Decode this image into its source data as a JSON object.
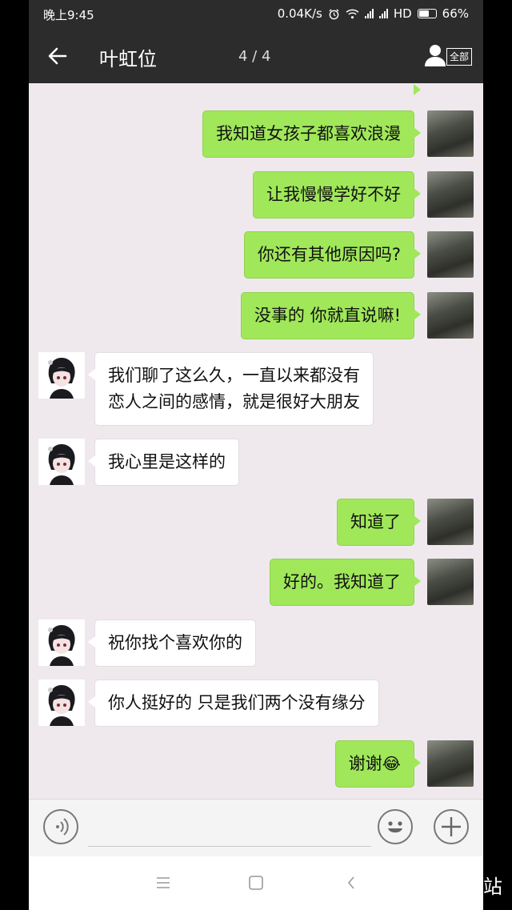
{
  "status_bar": {
    "time": "晚上9:45",
    "network_speed": "0.04K/s",
    "network_type": "HD",
    "battery": "66%",
    "battery_level": 0.66
  },
  "header": {
    "back_icon": "arrow-left-icon",
    "title": "叶虹位",
    "pager": "4 / 4",
    "contacts_label": "全部"
  },
  "messages": [
    {
      "side": "out",
      "text": "我知道女孩子都喜欢浪漫"
    },
    {
      "side": "out",
      "text": "让我慢慢学好不好"
    },
    {
      "side": "out",
      "text": "你还有其他原因吗?"
    },
    {
      "side": "out",
      "text": "没事的 你就直说嘛!"
    },
    {
      "side": "in",
      "lines": [
        "我们聊了这么久，一直以来都没有",
        "恋人之间的感情，就是很好大朋友"
      ]
    },
    {
      "side": "in",
      "text": "我心里是这样的"
    },
    {
      "side": "out",
      "text": "知道了"
    },
    {
      "side": "out",
      "text": "好的。我知道了"
    },
    {
      "side": "in",
      "text": "祝你找个喜欢你的"
    },
    {
      "side": "in",
      "text": "你人挺好的 只是我们两个没有缘分"
    },
    {
      "side": "out",
      "text": "谢谢",
      "emoji": "😂"
    }
  ],
  "input_bar": {
    "voice_icon": "voice-icon",
    "emoji_icon": "emoji-icon",
    "plus_icon": "plus-icon",
    "placeholder": ""
  },
  "nav_bar": {
    "menu_icon": "menu-icon",
    "home_icon": "home-icon",
    "back_icon": "back-chevron-icon"
  },
  "watermark": "站"
}
